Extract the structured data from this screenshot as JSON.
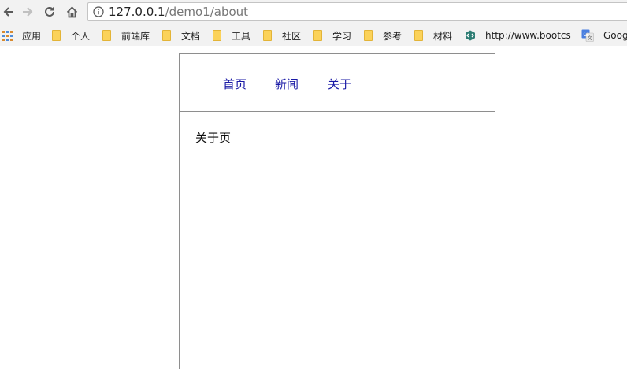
{
  "browser": {
    "url_host": "127.0.0.1",
    "url_path": "/demo1/about"
  },
  "bookmarks": [
    {
      "label": "应用",
      "icon": "apps-icon"
    },
    {
      "label": "个人",
      "icon": "folder-icon"
    },
    {
      "label": "前端库",
      "icon": "folder-icon"
    },
    {
      "label": "文档",
      "icon": "folder-icon"
    },
    {
      "label": "工具",
      "icon": "folder-icon"
    },
    {
      "label": "社区",
      "icon": "folder-icon"
    },
    {
      "label": "学习",
      "icon": "folder-icon"
    },
    {
      "label": "参考",
      "icon": "folder-icon"
    },
    {
      "label": "材料",
      "icon": "folder-icon"
    },
    {
      "label": "http://www.bootcs",
      "icon": "bootcss-icon"
    },
    {
      "label": "Goog",
      "icon": "google-translate-icon"
    }
  ],
  "page": {
    "nav": [
      {
        "label": "首页"
      },
      {
        "label": "新闻"
      },
      {
        "label": "关于"
      }
    ],
    "content_text": "关于页"
  },
  "colors": {
    "link": "#1a1aa6",
    "border": "#8e8e8e",
    "folder": "#fbd25a"
  }
}
